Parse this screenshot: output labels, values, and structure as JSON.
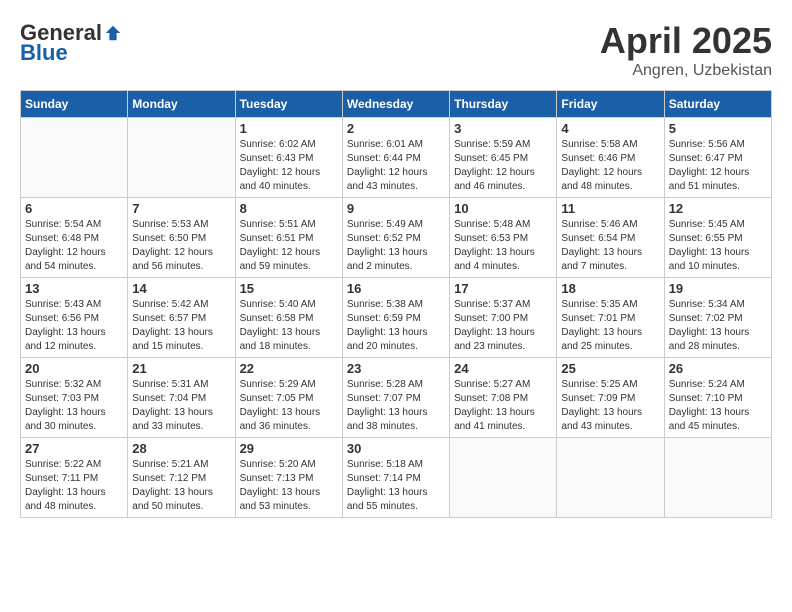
{
  "header": {
    "logo_general": "General",
    "logo_blue": "Blue",
    "month": "April 2025",
    "location": "Angren, Uzbekistan"
  },
  "days_of_week": [
    "Sunday",
    "Monday",
    "Tuesday",
    "Wednesday",
    "Thursday",
    "Friday",
    "Saturday"
  ],
  "weeks": [
    [
      {
        "day": "",
        "info": ""
      },
      {
        "day": "",
        "info": ""
      },
      {
        "day": "1",
        "info": "Sunrise: 6:02 AM\nSunset: 6:43 PM\nDaylight: 12 hours\nand 40 minutes."
      },
      {
        "day": "2",
        "info": "Sunrise: 6:01 AM\nSunset: 6:44 PM\nDaylight: 12 hours\nand 43 minutes."
      },
      {
        "day": "3",
        "info": "Sunrise: 5:59 AM\nSunset: 6:45 PM\nDaylight: 12 hours\nand 46 minutes."
      },
      {
        "day": "4",
        "info": "Sunrise: 5:58 AM\nSunset: 6:46 PM\nDaylight: 12 hours\nand 48 minutes."
      },
      {
        "day": "5",
        "info": "Sunrise: 5:56 AM\nSunset: 6:47 PM\nDaylight: 12 hours\nand 51 minutes."
      }
    ],
    [
      {
        "day": "6",
        "info": "Sunrise: 5:54 AM\nSunset: 6:48 PM\nDaylight: 12 hours\nand 54 minutes."
      },
      {
        "day": "7",
        "info": "Sunrise: 5:53 AM\nSunset: 6:50 PM\nDaylight: 12 hours\nand 56 minutes."
      },
      {
        "day": "8",
        "info": "Sunrise: 5:51 AM\nSunset: 6:51 PM\nDaylight: 12 hours\nand 59 minutes."
      },
      {
        "day": "9",
        "info": "Sunrise: 5:49 AM\nSunset: 6:52 PM\nDaylight: 13 hours\nand 2 minutes."
      },
      {
        "day": "10",
        "info": "Sunrise: 5:48 AM\nSunset: 6:53 PM\nDaylight: 13 hours\nand 4 minutes."
      },
      {
        "day": "11",
        "info": "Sunrise: 5:46 AM\nSunset: 6:54 PM\nDaylight: 13 hours\nand 7 minutes."
      },
      {
        "day": "12",
        "info": "Sunrise: 5:45 AM\nSunset: 6:55 PM\nDaylight: 13 hours\nand 10 minutes."
      }
    ],
    [
      {
        "day": "13",
        "info": "Sunrise: 5:43 AM\nSunset: 6:56 PM\nDaylight: 13 hours\nand 12 minutes."
      },
      {
        "day": "14",
        "info": "Sunrise: 5:42 AM\nSunset: 6:57 PM\nDaylight: 13 hours\nand 15 minutes."
      },
      {
        "day": "15",
        "info": "Sunrise: 5:40 AM\nSunset: 6:58 PM\nDaylight: 13 hours\nand 18 minutes."
      },
      {
        "day": "16",
        "info": "Sunrise: 5:38 AM\nSunset: 6:59 PM\nDaylight: 13 hours\nand 20 minutes."
      },
      {
        "day": "17",
        "info": "Sunrise: 5:37 AM\nSunset: 7:00 PM\nDaylight: 13 hours\nand 23 minutes."
      },
      {
        "day": "18",
        "info": "Sunrise: 5:35 AM\nSunset: 7:01 PM\nDaylight: 13 hours\nand 25 minutes."
      },
      {
        "day": "19",
        "info": "Sunrise: 5:34 AM\nSunset: 7:02 PM\nDaylight: 13 hours\nand 28 minutes."
      }
    ],
    [
      {
        "day": "20",
        "info": "Sunrise: 5:32 AM\nSunset: 7:03 PM\nDaylight: 13 hours\nand 30 minutes."
      },
      {
        "day": "21",
        "info": "Sunrise: 5:31 AM\nSunset: 7:04 PM\nDaylight: 13 hours\nand 33 minutes."
      },
      {
        "day": "22",
        "info": "Sunrise: 5:29 AM\nSunset: 7:05 PM\nDaylight: 13 hours\nand 36 minutes."
      },
      {
        "day": "23",
        "info": "Sunrise: 5:28 AM\nSunset: 7:07 PM\nDaylight: 13 hours\nand 38 minutes."
      },
      {
        "day": "24",
        "info": "Sunrise: 5:27 AM\nSunset: 7:08 PM\nDaylight: 13 hours\nand 41 minutes."
      },
      {
        "day": "25",
        "info": "Sunrise: 5:25 AM\nSunset: 7:09 PM\nDaylight: 13 hours\nand 43 minutes."
      },
      {
        "day": "26",
        "info": "Sunrise: 5:24 AM\nSunset: 7:10 PM\nDaylight: 13 hours\nand 45 minutes."
      }
    ],
    [
      {
        "day": "27",
        "info": "Sunrise: 5:22 AM\nSunset: 7:11 PM\nDaylight: 13 hours\nand 48 minutes."
      },
      {
        "day": "28",
        "info": "Sunrise: 5:21 AM\nSunset: 7:12 PM\nDaylight: 13 hours\nand 50 minutes."
      },
      {
        "day": "29",
        "info": "Sunrise: 5:20 AM\nSunset: 7:13 PM\nDaylight: 13 hours\nand 53 minutes."
      },
      {
        "day": "30",
        "info": "Sunrise: 5:18 AM\nSunset: 7:14 PM\nDaylight: 13 hours\nand 55 minutes."
      },
      {
        "day": "",
        "info": ""
      },
      {
        "day": "",
        "info": ""
      },
      {
        "day": "",
        "info": ""
      }
    ]
  ]
}
